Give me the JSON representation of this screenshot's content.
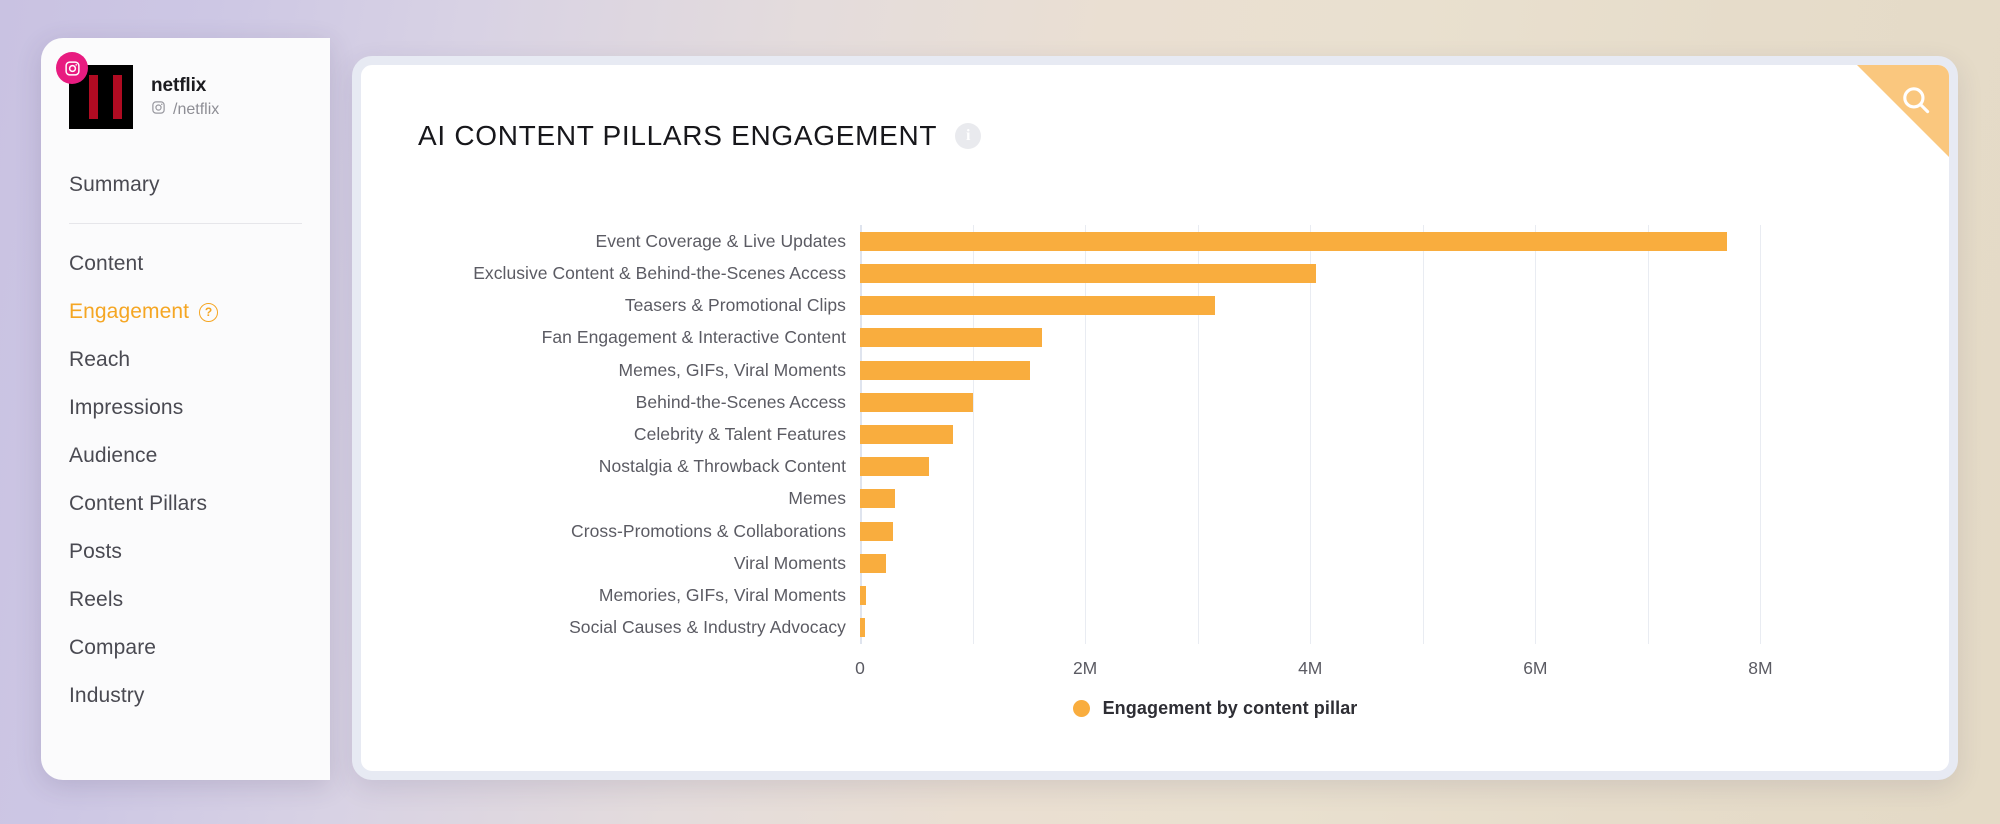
{
  "sidebar": {
    "profile": {
      "name": "netflix",
      "handle": "/netflix",
      "platform_icon": "instagram-icon",
      "avatar_icon": "netflix-logo"
    },
    "items": [
      {
        "label": "Summary",
        "active": false,
        "help": false
      },
      {
        "label": "Content",
        "active": false,
        "help": false
      },
      {
        "label": "Engagement",
        "active": true,
        "help": true
      },
      {
        "label": "Reach",
        "active": false,
        "help": false
      },
      {
        "label": "Impressions",
        "active": false,
        "help": false
      },
      {
        "label": "Audience",
        "active": false,
        "help": false
      },
      {
        "label": "Content Pillars",
        "active": false,
        "help": false
      },
      {
        "label": "Posts",
        "active": false,
        "help": false
      },
      {
        "label": "Reels",
        "active": false,
        "help": false
      },
      {
        "label": "Compare",
        "active": false,
        "help": false
      },
      {
        "label": "Industry",
        "active": false,
        "help": false
      }
    ],
    "help_badge_glyph": "?"
  },
  "card": {
    "title": "AI CONTENT PILLARS ENGAGEMENT",
    "info_icon": "info-icon",
    "info_glyph": "i",
    "search_icon": "search-icon"
  },
  "colors": {
    "bar": "#f9ad3e",
    "accent": "#f5a623",
    "ribbon": "#fac77e",
    "instagram_badge": "#e81b80",
    "card_border": "#e7eaf3"
  },
  "chart_data": {
    "type": "bar",
    "orientation": "horizontal",
    "title": "AI CONTENT PILLARS ENGAGEMENT",
    "xlabel": "",
    "ylabel": "",
    "xlim": [
      0,
      8600000
    ],
    "grid": true,
    "gridlines": [
      0,
      1000000,
      2000000,
      3000000,
      4000000,
      5000000,
      6000000,
      7000000,
      8000000
    ],
    "xticks": [
      0,
      2000000,
      4000000,
      6000000,
      8000000
    ],
    "xtick_labels": [
      "0",
      "2M",
      "4M",
      "6M",
      "8M"
    ],
    "legend": {
      "position": "bottom",
      "entries": [
        "Engagement by content pillar"
      ]
    },
    "categories": [
      "Event Coverage & Live Updates",
      "Exclusive Content & Behind-the-Scenes Access",
      "Teasers & Promotional Clips",
      "Fan Engagement & Interactive Content",
      "Memes, GIFs, Viral Moments",
      "Behind-the-Scenes Access",
      "Celebrity & Talent Features",
      "Nostalgia & Throwback Content",
      "Memes",
      "Cross-Promotions & Collaborations",
      "Viral Moments",
      "Memories, GIFs, Viral Moments",
      "Social Causes & Industry Advocacy"
    ],
    "values": [
      7700000,
      4050000,
      3150000,
      1620000,
      1510000,
      1000000,
      830000,
      610000,
      310000,
      290000,
      230000,
      50000,
      45000
    ],
    "series": [
      {
        "name": "Engagement by content pillar",
        "color": "#f9ad3e",
        "values": [
          7700000,
          4050000,
          3150000,
          1620000,
          1510000,
          1000000,
          830000,
          610000,
          310000,
          290000,
          230000,
          50000,
          45000
        ]
      }
    ]
  }
}
